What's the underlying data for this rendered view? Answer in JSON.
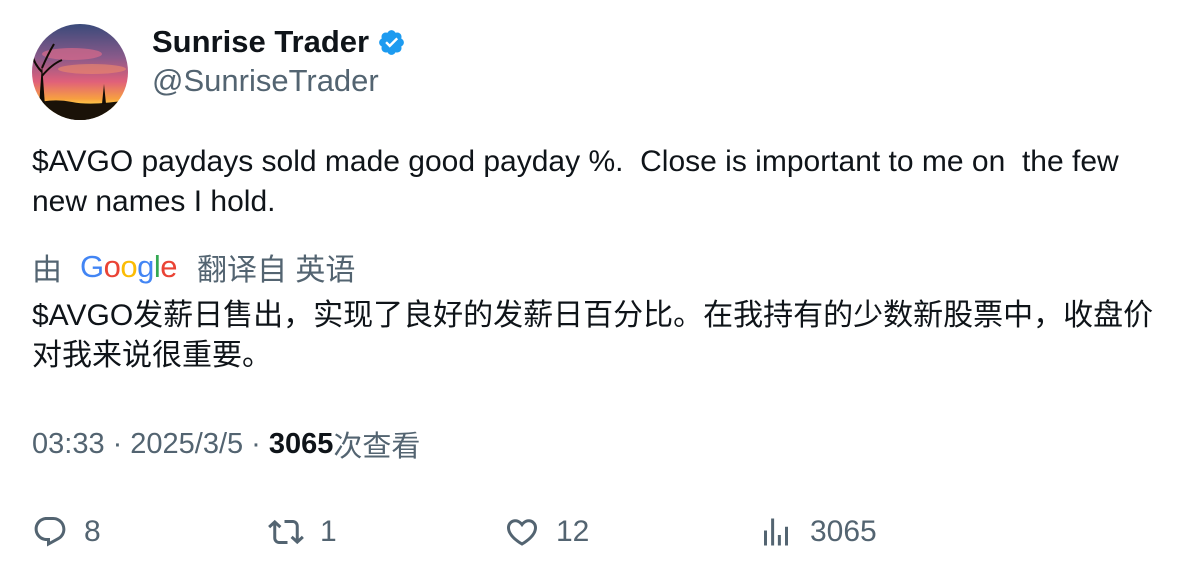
{
  "user": {
    "display_name": "Sunrise Trader",
    "handle": "@SunriseTrader",
    "verified": true
  },
  "tweet": {
    "text": "$AVGO paydays sold made good payday %.  Close is important to me on  the few  new names I hold."
  },
  "translation": {
    "prefix": "由",
    "provider_letters": [
      "G",
      "o",
      "o",
      "g",
      "l",
      "e"
    ],
    "suffix": "翻译自 英语",
    "text": "$AVGO发薪日售出，实现了良好的发薪日百分比。在我持有的少数新股票中，收盘价对我来说很重要。"
  },
  "meta": {
    "time": "03:33",
    "separator": "·",
    "date": "2025/3/5",
    "views": "3065",
    "views_label": "次查看"
  },
  "actions": {
    "replies": "8",
    "retweets": "1",
    "likes": "12",
    "views": "3065"
  },
  "colors": {
    "text_primary": "#0f1419",
    "text_secondary": "#536471",
    "verified_blue": "#1d9bf0"
  },
  "icons": {
    "verified": "verified-badge-icon",
    "reply": "reply-icon",
    "retweet": "retweet-icon",
    "like": "heart-icon",
    "views": "bar-chart-icon"
  }
}
